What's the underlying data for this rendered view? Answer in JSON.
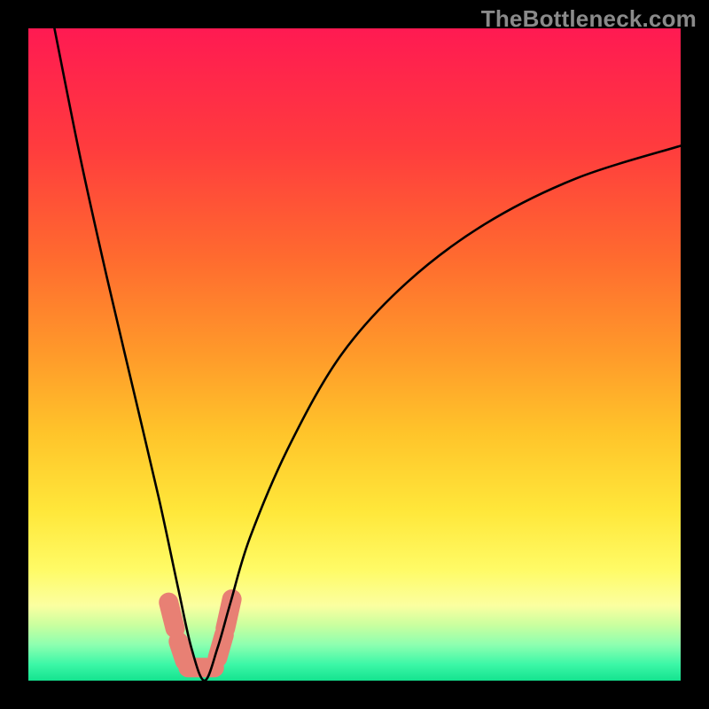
{
  "watermark": "TheBottleneck.com",
  "chart_data": {
    "type": "line",
    "title": "",
    "xlabel": "",
    "ylabel": "",
    "xlim": [
      0,
      100
    ],
    "ylim": [
      0,
      100
    ],
    "curve": {
      "note": "V-shaped bottleneck curve; y≈0 near x≈27, rising toward both edges",
      "x": [
        4,
        8,
        12,
        16,
        20,
        23,
        25,
        27,
        29,
        31,
        34,
        40,
        48,
        58,
        70,
        84,
        100
      ],
      "y": [
        100,
        80,
        62,
        45,
        28,
        14,
        5,
        0,
        5,
        12,
        22,
        36,
        50,
        61,
        70,
        77,
        82
      ]
    },
    "marker_band": {
      "note": "Salmon rounded marker segments near the valley",
      "segments": [
        {
          "x0": 21.5,
          "y0": 12.0,
          "x1": 22.5,
          "y1": 8.0
        },
        {
          "x0": 23.0,
          "y0": 6.0,
          "x1": 24.0,
          "y1": 3.0
        },
        {
          "x0": 24.5,
          "y0": 2.0,
          "x1": 28.5,
          "y1": 2.0
        },
        {
          "x0": 29.0,
          "y0": 3.5,
          "x1": 30.0,
          "y1": 7.0
        },
        {
          "x0": 30.2,
          "y0": 8.0,
          "x1": 31.2,
          "y1": 12.5
        }
      ],
      "color": "#e88074"
    },
    "background_gradient": {
      "stops": [
        {
          "offset": 0.0,
          "color": "#ff1a52"
        },
        {
          "offset": 0.18,
          "color": "#ff3b3e"
        },
        {
          "offset": 0.35,
          "color": "#ff6a2f"
        },
        {
          "offset": 0.5,
          "color": "#ff9a2a"
        },
        {
          "offset": 0.62,
          "color": "#ffc42a"
        },
        {
          "offset": 0.74,
          "color": "#ffe73a"
        },
        {
          "offset": 0.83,
          "color": "#fffb66"
        },
        {
          "offset": 0.885,
          "color": "#fbffa0"
        },
        {
          "offset": 0.915,
          "color": "#c9ff9f"
        },
        {
          "offset": 0.945,
          "color": "#8dffb0"
        },
        {
          "offset": 0.975,
          "color": "#3cf7a7"
        },
        {
          "offset": 1.0,
          "color": "#14e38f"
        }
      ]
    }
  }
}
